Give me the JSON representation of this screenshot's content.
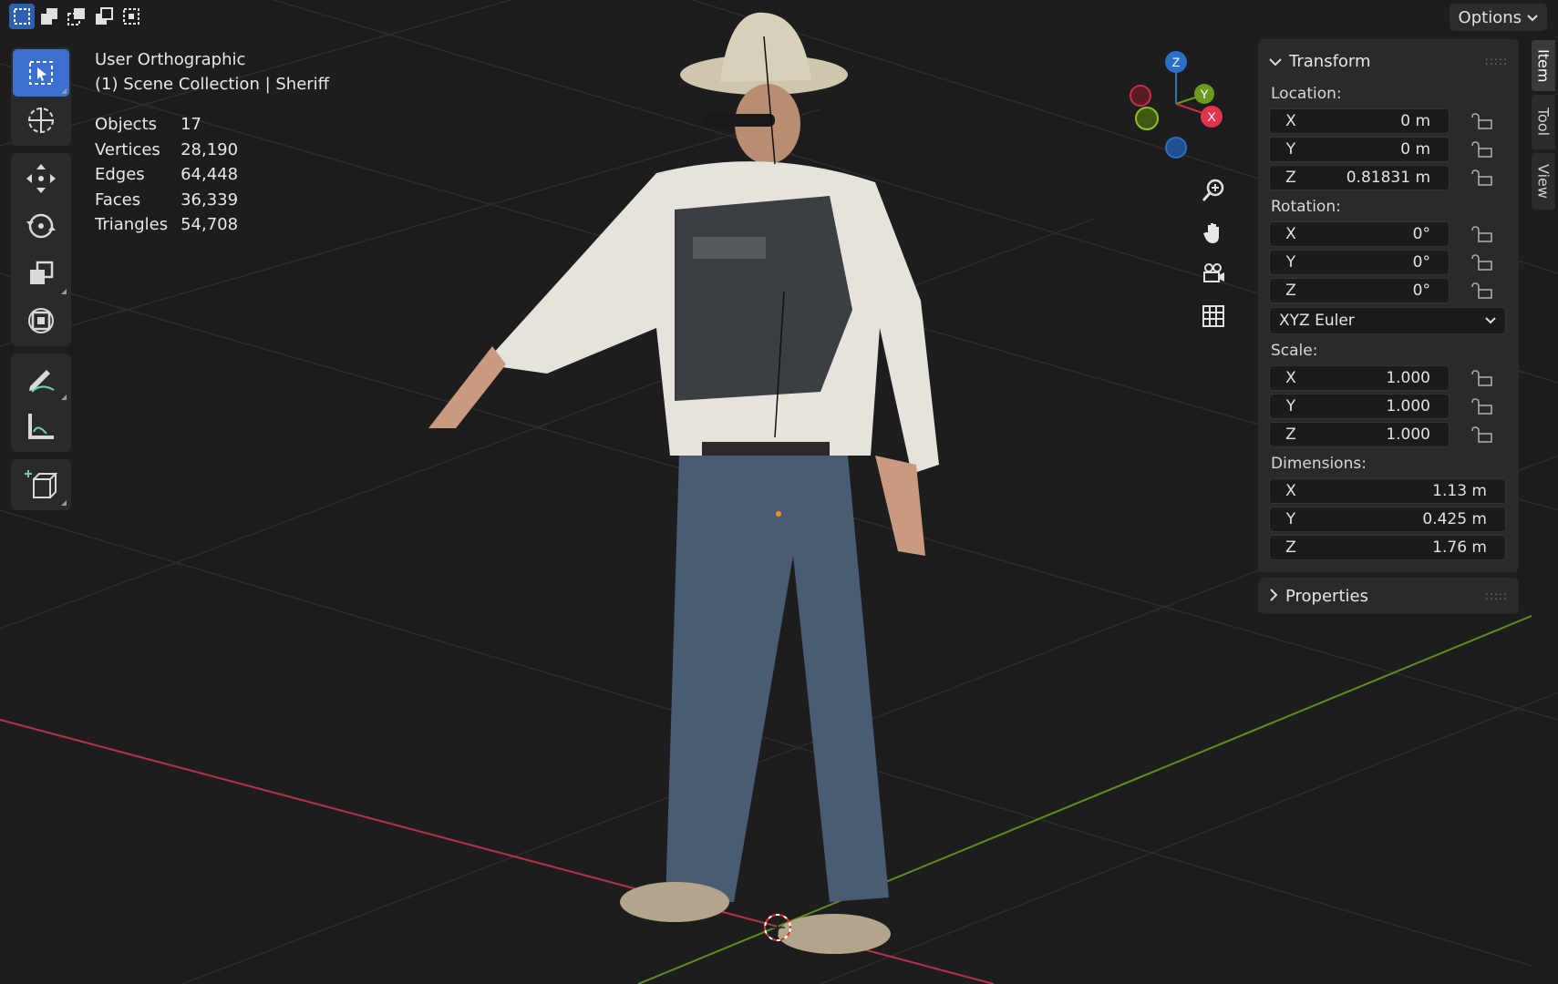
{
  "header": {
    "select_modes": [
      "select-new-icon",
      "select-extend-icon",
      "select-subtract-icon",
      "select-invert-icon",
      "select-intersect-icon"
    ],
    "options_label": "Options"
  },
  "toolbar": {
    "tools": [
      "select-box",
      "cursor",
      "move",
      "rotate",
      "scale",
      "transform",
      "annotate",
      "measure",
      "add-cube"
    ]
  },
  "overlay": {
    "view_name": "User Orthographic",
    "collection": "(1) Scene Collection | Sheriff",
    "stats": [
      {
        "label": "Objects",
        "value": "17"
      },
      {
        "label": "Vertices",
        "value": "28,190"
      },
      {
        "label": "Edges",
        "value": "64,448"
      },
      {
        "label": "Faces",
        "value": "36,339"
      },
      {
        "label": "Triangles",
        "value": "54,708"
      }
    ]
  },
  "gizmo": {
    "x": "X",
    "y": "Y",
    "z": "Z"
  },
  "sidebar": {
    "transform_title": "Transform",
    "location_label": "Location:",
    "location": [
      {
        "axis": "X",
        "value": "0 m"
      },
      {
        "axis": "Y",
        "value": "0 m"
      },
      {
        "axis": "Z",
        "value": "0.81831 m"
      }
    ],
    "rotation_label": "Rotation:",
    "rotation": [
      {
        "axis": "X",
        "value": "0°"
      },
      {
        "axis": "Y",
        "value": "0°"
      },
      {
        "axis": "Z",
        "value": "0°"
      }
    ],
    "rotation_mode": "XYZ Euler",
    "scale_label": "Scale:",
    "scale": [
      {
        "axis": "X",
        "value": "1.000"
      },
      {
        "axis": "Y",
        "value": "1.000"
      },
      {
        "axis": "Z",
        "value": "1.000"
      }
    ],
    "dimensions_label": "Dimensions:",
    "dimensions": [
      {
        "axis": "X",
        "value": "1.13 m"
      },
      {
        "axis": "Y",
        "value": "0.425 m"
      },
      {
        "axis": "Z",
        "value": "1.76 m"
      }
    ],
    "properties_title": "Properties",
    "tabs": [
      "Item",
      "Tool",
      "View"
    ]
  },
  "colors": {
    "x_axis": "#c4314b",
    "y_axis": "#6c9a1e",
    "z_axis": "#2b6fc7",
    "active": "#3b6fd0"
  }
}
